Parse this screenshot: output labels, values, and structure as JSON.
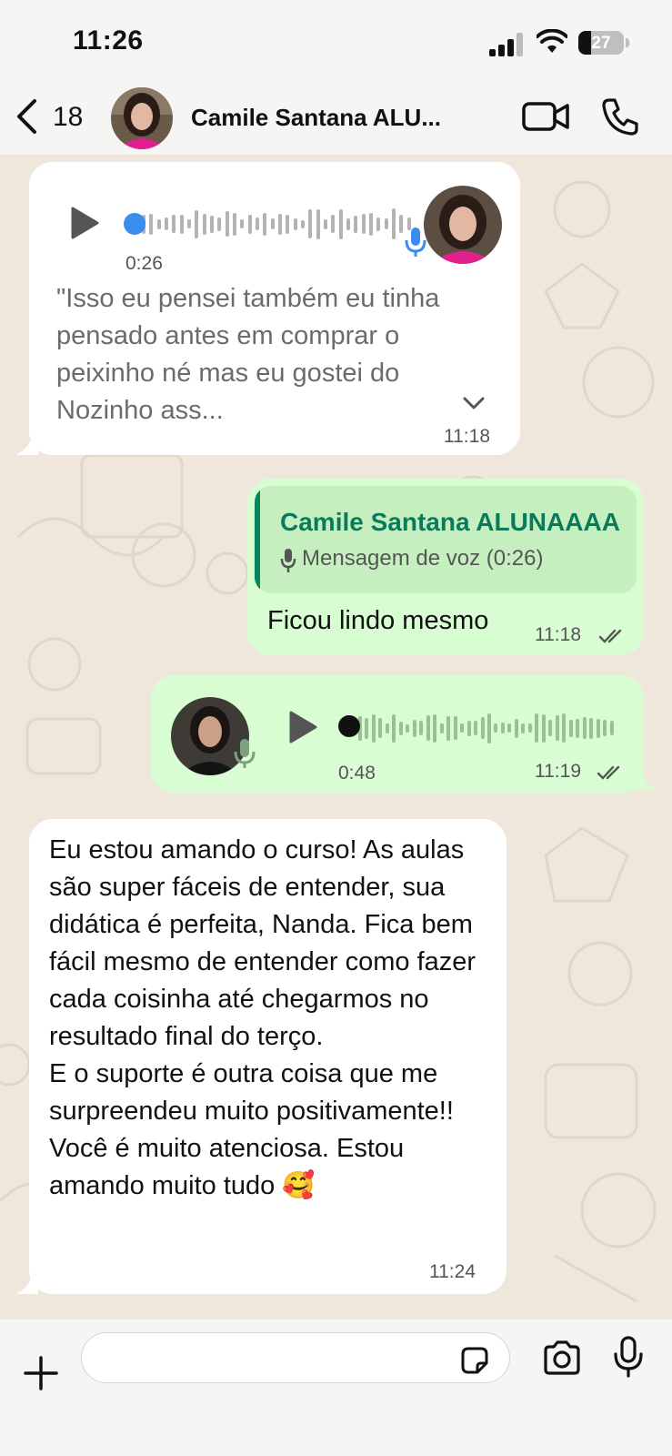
{
  "status": {
    "time": "11:26",
    "battery": "27",
    "battery_level": 0.27
  },
  "header": {
    "back_count": "18",
    "contact_name": "Camile Santana ALU..."
  },
  "messages": {
    "m1": {
      "direction": "incoming",
      "type": "voice",
      "duration": "0:26",
      "transcript": "\"Isso eu pensei também eu tinha pensado antes em comprar o peixinho né mas eu gostei do Nozinho ass...",
      "time": "11:18"
    },
    "m2": {
      "direction": "outgoing",
      "quote_author": "Camile Santana ALUNAAAA",
      "quote_text": "Mensagem de voz (0:26)",
      "text": "Ficou lindo mesmo",
      "time": "11:18",
      "status": "read"
    },
    "m3": {
      "direction": "outgoing",
      "type": "voice",
      "duration": "0:48",
      "time": "11:19",
      "status": "read"
    },
    "m4": {
      "direction": "incoming",
      "text": "Eu estou amando o curso! As aulas são super fáceis de entender, sua didática é perfeita, Nanda. Fica bem fácil mesmo de entender como fazer cada coisinha até chegarmos no resultado final do terço.\nE o suporte é outra coisa que me surpreendeu muito positivamente!! Você é muito atenciosa. Estou amando muito tudo 🥰",
      "time": "11:24"
    }
  },
  "composer": {
    "value": "",
    "placeholder": ""
  },
  "colors": {
    "incoming_bubble": "#ffffff",
    "outgoing_bubble": "#d8fdd2",
    "quote_accent": "#06845c",
    "chat_bg": "#efe7dc",
    "voice_dot_incoming": "#3b8cf0",
    "mic_badge_incoming": "#3b8cf0",
    "mic_badge_outgoing": "#7fa07f"
  },
  "icons": [
    "back-chevron-icon",
    "video-call-icon",
    "phone-icon",
    "play-icon",
    "mic-icon",
    "double-check-icon",
    "chevron-down-icon",
    "plus-icon",
    "sticker-icon",
    "camera-icon"
  ]
}
